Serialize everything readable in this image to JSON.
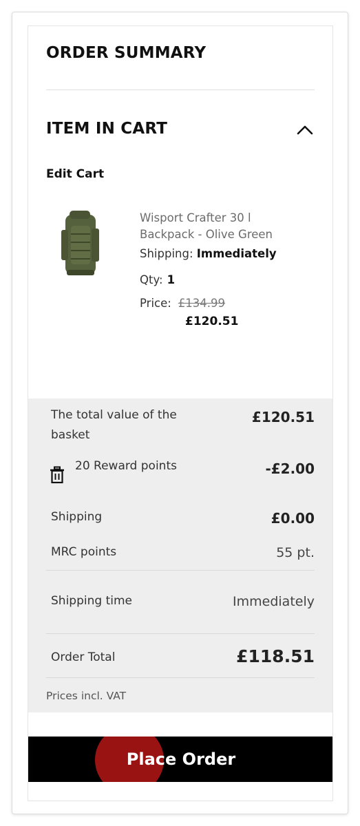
{
  "order_summary": {
    "title": "ORDER SUMMARY"
  },
  "cart": {
    "title": "ITEM IN CART",
    "toggle_icon": "chevron-up-icon",
    "edit_label": "Edit Cart",
    "item": {
      "image_icon": "backpack-image",
      "name": "Wisport Crafter 30 l Backpack - Olive Green",
      "shipping_label": "Shipping:",
      "shipping_value": "Immediately",
      "qty_label": "Qty:",
      "qty_value": "1",
      "price_label": "Price:",
      "old_price": "£134.99",
      "new_price": "£120.51"
    }
  },
  "totals": {
    "basket_label": "The total value of the basket",
    "basket_value": "£120.51",
    "reward_label": "20 Reward points",
    "reward_value": "-£2.00",
    "reward_icon": "trash-icon",
    "shipping_label": "Shipping",
    "shipping_value": "£0.00",
    "mrc_label": "MRC points",
    "mrc_value": "55 pt.",
    "shipping_time_label": "Shipping time",
    "shipping_time_value": "Immediately",
    "order_total_label": "Order Total",
    "order_total_value": "£118.51",
    "vat_note": "Prices incl. VAT"
  },
  "actions": {
    "place_order_label": "Place Order"
  },
  "colors": {
    "button_bg": "#000000",
    "totals_bg": "#eeeeee",
    "tap_highlight": "#e64646"
  }
}
